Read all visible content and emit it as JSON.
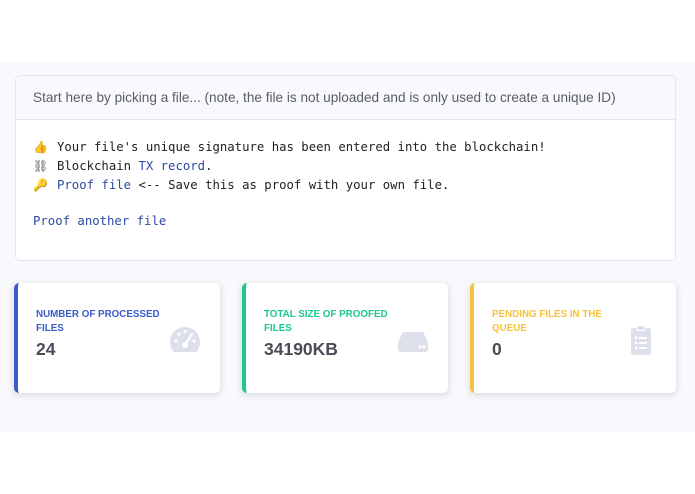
{
  "file_picker": {
    "header": "Start here by picking a file... (note, the file is not uploaded and is only used to create a unique ID)"
  },
  "result": {
    "line1_emoji": "👍",
    "line1_text": "Your file's unique signature has been entered into the blockchain!",
    "line2_emoji": "⛓",
    "line2_text": "Blockchain ",
    "line2_link": "TX record",
    "line2_after": ".",
    "line3_emoji": "🔑",
    "line3_link": "Proof file",
    "line3_text": " <-- Save this as proof with your own file.",
    "proof_another": "Proof another file"
  },
  "stats": [
    {
      "label": "Number of processed files",
      "value": "24",
      "icon": "tachometer-icon",
      "color": "#3c5bc9"
    },
    {
      "label": "Total size of proofed files",
      "value": "34190KB",
      "icon": "hdd-icon",
      "color": "#1cc88a"
    },
    {
      "label": "Pending files in the queue",
      "value": "0",
      "icon": "clipboard-list-icon",
      "color": "#f6c23e"
    }
  ],
  "colors": {
    "link": "#2e4aa3",
    "icon_gray": "#dddfeb",
    "text_dark": "#4a4b55"
  }
}
